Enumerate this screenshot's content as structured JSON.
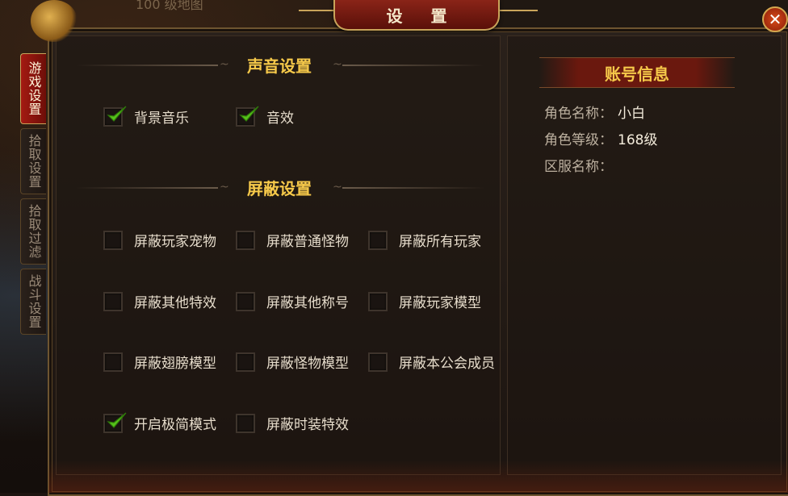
{
  "window": {
    "title": "设 置",
    "background_text": "100 级地图"
  },
  "tabs": [
    {
      "label": "游戏设置",
      "active": true
    },
    {
      "label": "拾取设置",
      "active": false
    },
    {
      "label": "拾取过滤",
      "active": false
    },
    {
      "label": "战斗设置",
      "active": false
    }
  ],
  "sound": {
    "header": "声音设置",
    "options": [
      {
        "label": "背景音乐",
        "checked": true
      },
      {
        "label": "音效",
        "checked": true
      }
    ]
  },
  "shield": {
    "header": "屏蔽设置",
    "options": [
      {
        "label": "屏蔽玩家宠物",
        "checked": false
      },
      {
        "label": "屏蔽普通怪物",
        "checked": false
      },
      {
        "label": "屏蔽所有玩家",
        "checked": false
      },
      {
        "label": "屏蔽其他特效",
        "checked": false
      },
      {
        "label": "屏蔽其他称号",
        "checked": false
      },
      {
        "label": "屏蔽玩家模型",
        "checked": false
      },
      {
        "label": "屏蔽翅膀模型",
        "checked": false
      },
      {
        "label": "屏蔽怪物模型",
        "checked": false
      },
      {
        "label": "屏蔽本公会成员",
        "checked": false
      },
      {
        "label": "开启极简模式",
        "checked": true
      },
      {
        "label": "屏蔽时装特效",
        "checked": false
      }
    ]
  },
  "account": {
    "header": "账号信息",
    "rows": [
      {
        "label": "角色名称：",
        "value": "小白"
      },
      {
        "label": "角色等级：",
        "value": "168级"
      },
      {
        "label": "区服名称：",
        "value": ""
      }
    ]
  },
  "icons": {
    "close": "close-icon",
    "check": "check-icon"
  },
  "colors": {
    "accent_gold": "#f6c94a",
    "tab_active": "#a41a12",
    "check_green": "#56c21a"
  }
}
